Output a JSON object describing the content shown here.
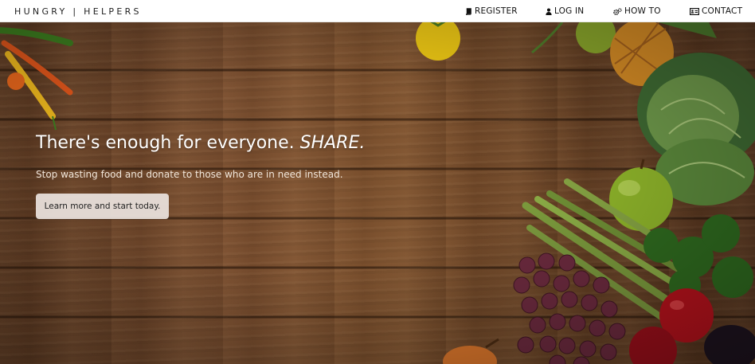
{
  "brand": "HUNGRY | HELPERS",
  "nav": {
    "register": "REGISTER",
    "login": "LOG IN",
    "howto": "HOW TO",
    "contact": "CONTACT"
  },
  "hero": {
    "headline_main": "There's enough for everyone. ",
    "headline_emph": "SHARE.",
    "subtitle": "Stop wasting food and donate to those who are in need instead.",
    "cta_label": "Learn more and start today."
  },
  "icons": {
    "register": "book-icon",
    "login": "user-icon",
    "howto": "cogs-icon",
    "contact": "id-card-icon"
  }
}
